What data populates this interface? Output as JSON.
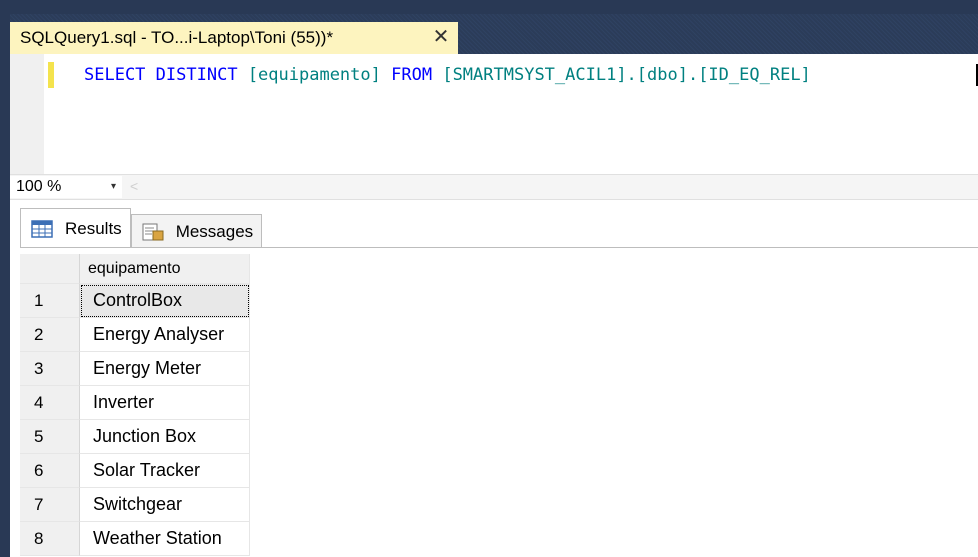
{
  "document_tab": {
    "title": "SQLQuery1.sql - TO...i-Laptop\\Toni (55))*",
    "close_glyph": "✕"
  },
  "editor": {
    "tokens": [
      {
        "text": "SELECT",
        "kind": "keyword"
      },
      {
        "text": " ",
        "kind": "space"
      },
      {
        "text": "DISTINCT",
        "kind": "keyword"
      },
      {
        "text": " ",
        "kind": "space"
      },
      {
        "text": "[equipamento]",
        "kind": "identifier"
      },
      {
        "text": " ",
        "kind": "space"
      },
      {
        "text": "FROM",
        "kind": "keyword"
      },
      {
        "text": " ",
        "kind": "space"
      },
      {
        "text": "[SMARTMSYST_ACIL1].[dbo].[ID_EQ_REL]",
        "kind": "identifier"
      }
    ]
  },
  "zoom": {
    "value": "100 %",
    "arrow": "▾",
    "scroll_left": "<"
  },
  "results_tabs": [
    {
      "label": "Results",
      "icon": "grid-icon",
      "active": true
    },
    {
      "label": "Messages",
      "icon": "messages-icon",
      "active": false
    }
  ],
  "grid": {
    "column": "equipamento",
    "rows": [
      {
        "num": "1",
        "value": "ControlBox"
      },
      {
        "num": "2",
        "value": "Energy Analyser"
      },
      {
        "num": "3",
        "value": "Energy Meter"
      },
      {
        "num": "4",
        "value": "Inverter"
      },
      {
        "num": "5",
        "value": "Junction Box"
      },
      {
        "num": "6",
        "value": "Solar Tracker"
      },
      {
        "num": "7",
        "value": "Switchgear"
      },
      {
        "num": "8",
        "value": "Weather Station"
      }
    ]
  },
  "colors": {
    "ide_background": "#293955",
    "active_tab": "#fdf4bf",
    "keyword": "#0000ff",
    "identifier": "#008080",
    "change_bar": "#f4e34d"
  }
}
